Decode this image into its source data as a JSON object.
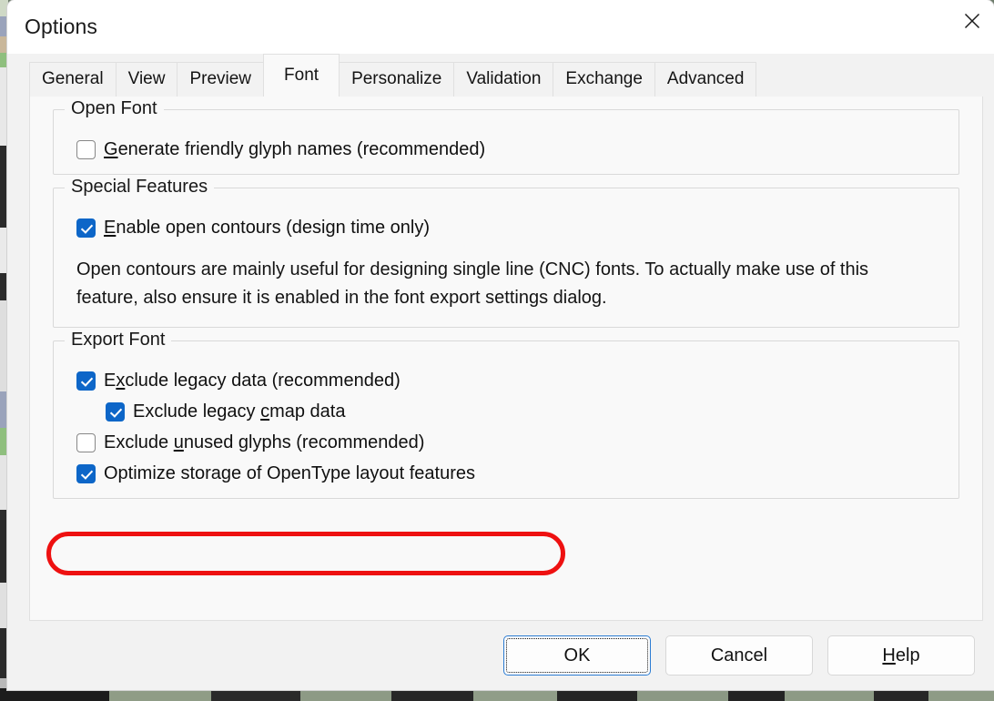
{
  "window": {
    "title": "Options",
    "close_icon": "close-icon"
  },
  "tabs": [
    {
      "label": "General",
      "active": false
    },
    {
      "label": "View",
      "active": false
    },
    {
      "label": "Preview",
      "active": false
    },
    {
      "label": "Font",
      "active": true
    },
    {
      "label": "Personalize",
      "active": false
    },
    {
      "label": "Validation",
      "active": false
    },
    {
      "label": "Exchange",
      "active": false
    },
    {
      "label": "Advanced",
      "active": false
    }
  ],
  "groups": {
    "open_font": {
      "legend": "Open Font",
      "checkbox": {
        "label_pre": "",
        "accel": "G",
        "label_post": "enerate friendly glyph names (recommended)",
        "checked": false
      }
    },
    "special_features": {
      "legend": "Special Features",
      "checkbox": {
        "label_pre": "",
        "accel": "E",
        "label_post": "nable open contours (design time only)",
        "checked": true
      },
      "help_text": "Open contours are mainly useful for designing single line (CNC) fonts. To actually make use of this feature, also ensure it is enabled in the font export settings dialog."
    },
    "export_font": {
      "legend": "Export Font",
      "checkboxes": [
        {
          "label_pre": "E",
          "accel": "x",
          "label_post": "clude legacy data (recommended)",
          "checked": true,
          "indent": false
        },
        {
          "label_pre": "Exclude legacy ",
          "accel": "c",
          "label_post": "map data",
          "checked": true,
          "indent": true
        },
        {
          "label_pre": "Exclude ",
          "accel": "u",
          "label_post": "nused glyphs (recommended)",
          "checked": false,
          "indent": false
        },
        {
          "label_pre": "Optimize storage of OpenType layout features",
          "accel": "",
          "label_post": "",
          "checked": true,
          "indent": false
        }
      ]
    }
  },
  "annotation": {
    "color": "#ee1111",
    "target": "Optimize storage of OpenType layout features"
  },
  "footer": {
    "ok": {
      "label_pre": "OK",
      "accel": "",
      "label_post": ""
    },
    "cancel": {
      "label_pre": "Cancel",
      "accel": "",
      "label_post": ""
    },
    "help": {
      "label_pre": "",
      "accel": "H",
      "label_post": "elp"
    }
  },
  "colors": {
    "accent": "#0d66c8",
    "annotation": "#ee1111",
    "panel": "#f9f9f9",
    "chrome": "#f2f2f2"
  }
}
